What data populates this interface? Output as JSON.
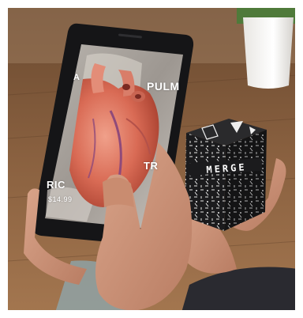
{
  "phone_screen": {
    "labels": {
      "top_left": "A",
      "top_right": "PULM",
      "right": "TR",
      "bottom_left": "RIC",
      "price": "$14.99"
    }
  },
  "cube": {
    "wordmark": "MERGE"
  }
}
